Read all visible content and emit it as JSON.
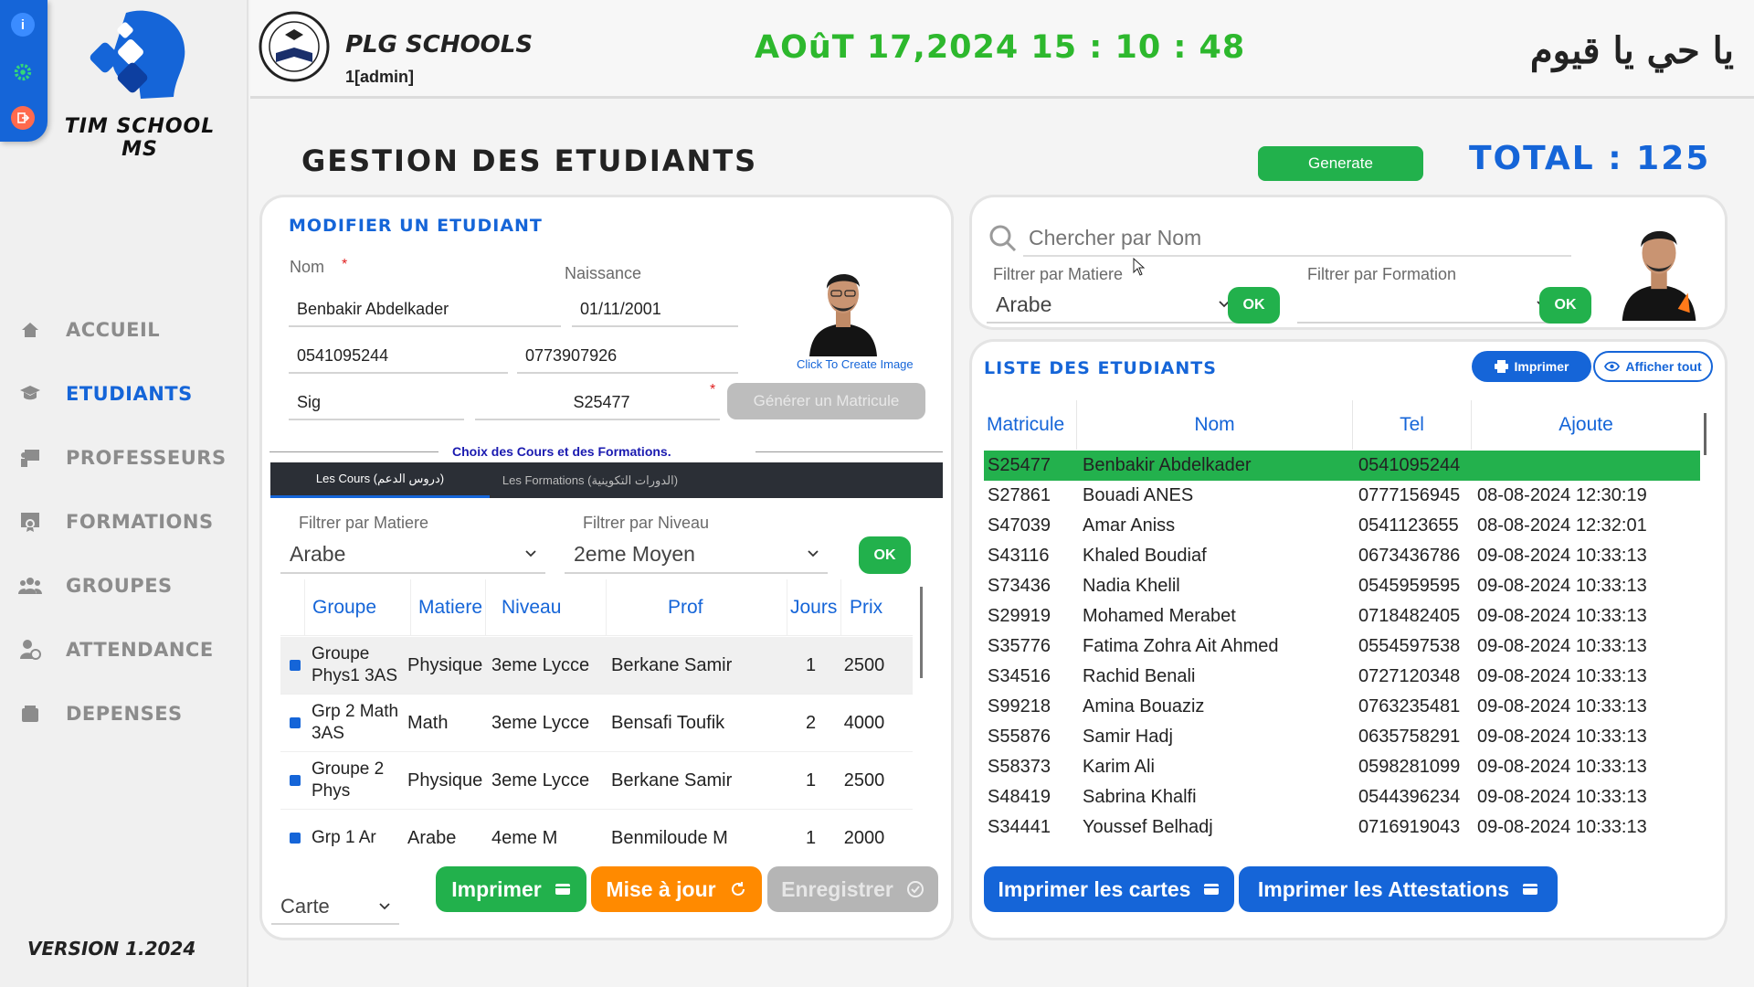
{
  "app": {
    "name": "TIM SCHOOL MS",
    "version": "VERSION 1.2024"
  },
  "top_strip": {
    "info_icon": "i",
    "settings_icon": "gear-icon",
    "logout_icon": "logout-icon"
  },
  "sidebar": {
    "items": [
      {
        "label": "ACCUEIL",
        "icon": "home-icon",
        "active": false
      },
      {
        "label": "ETUDIANTS",
        "icon": "graduation-cap-icon",
        "active": true
      },
      {
        "label": "PROFESSEURS",
        "icon": "teacher-icon",
        "active": false
      },
      {
        "label": "FORMATIONS",
        "icon": "certificate-icon",
        "active": false
      },
      {
        "label": "GROUPES",
        "icon": "users-icon",
        "active": false
      },
      {
        "label": "ATTENDANCE",
        "icon": "user-clock-icon",
        "active": false
      },
      {
        "label": "DEPENSES",
        "icon": "wallet-icon",
        "active": false
      }
    ]
  },
  "header": {
    "school_name": "PLG SCHOOLS",
    "user": "1[admin]",
    "datetime": "AOûT 17,2024 15 : 10 : 48",
    "arabic_text": "يا حي يا قيوم"
  },
  "page": {
    "title": "GESTION DES ETUDIANTS",
    "generate_label": "Generate",
    "total": "TOTAL : 125"
  },
  "edit_form": {
    "title": "MODIFIER UN ETUDIANT",
    "nom_label": "Nom",
    "required_mark": "*",
    "naissance_label": "Naissance",
    "nom": "Benbakir Abdelkader",
    "naissance": "01/11/2001",
    "tel1": "0541095244",
    "tel2": "0773907926",
    "adresse": "Sig",
    "matricule": "S25477",
    "generate_matricule_label": "Générer un Matricule",
    "photo_caption": "Click To Create Image",
    "choice_label": "Choix des Cours et des Formations.",
    "tabs": [
      "Les Cours (دروس الدعم)",
      "Les Formations (الدورات التكوينية)"
    ],
    "filter_matiere_label": "Filtrer par Matiere",
    "filter_matiere_value": "Arabe",
    "filter_niveau_label": "Filtrer par Niveau",
    "filter_niveau_value": "2eme Moyen",
    "ok_label": "OK",
    "course_columns": [
      "Groupe",
      "Matiere",
      "Niveau",
      "Prof",
      "Jours",
      "Prix"
    ],
    "courses": [
      {
        "groupe": "Groupe Phys1 3AS",
        "matiere": "Physique",
        "niveau": "3eme Lycce",
        "prof": "Berkane Samir",
        "jours": "1",
        "prix": "2500"
      },
      {
        "groupe": "Grp 2 Math 3AS",
        "matiere": "Math",
        "niveau": "3eme Lycce",
        "prof": "Bensafi Toufik",
        "jours": "2",
        "prix": "4000"
      },
      {
        "groupe": "Groupe 2 Phys",
        "matiere": "Physique",
        "niveau": "3eme Lycce",
        "prof": "Berkane Samir",
        "jours": "1",
        "prix": "2500"
      },
      {
        "groupe": "Grp 1 Ar",
        "matiere": "Arabe",
        "niveau": "4eme M",
        "prof": "Benmiloude M",
        "jours": "1",
        "prix": "2000"
      }
    ],
    "print_type_value": "Carte",
    "imprimer_label": "Imprimer",
    "update_label": "Mise à jour",
    "save_label": "Enregistrer"
  },
  "search_panel": {
    "search_placeholder": "Chercher par Nom",
    "filter_matiere_label": "Filtrer par Matiere",
    "filter_matiere_value": "Arabe",
    "filter_formation_label": "Filtrer par Formation",
    "filter_formation_value": "",
    "ok_label": "OK"
  },
  "students_list": {
    "title": "LISTE DES ETUDIANTS",
    "print_label": "Imprimer",
    "show_all_label": "Afficher tout",
    "columns": [
      "Matricule",
      "Nom",
      "Tel",
      "Ajoute"
    ],
    "rows": [
      {
        "matricule": "S25477",
        "nom": "Benbakir Abdelkader",
        "tel": "0541095244",
        "ajoute": "",
        "selected": true
      },
      {
        "matricule": "S27861",
        "nom": "Bouadi ANES",
        "tel": "0777156945",
        "ajoute": "08-08-2024 12:30:19"
      },
      {
        "matricule": "S47039",
        "nom": "Amar Aniss",
        "tel": "0541123655",
        "ajoute": "08-08-2024 12:32:01"
      },
      {
        "matricule": "S43116",
        "nom": "Khaled Boudiaf",
        "tel": "0673436786",
        "ajoute": "09-08-2024 10:33:13"
      },
      {
        "matricule": "S73436",
        "nom": "Nadia Khelil",
        "tel": "0545959595",
        "ajoute": "09-08-2024 10:33:13"
      },
      {
        "matricule": "S29919",
        "nom": "Mohamed Merabet",
        "tel": "0718482405",
        "ajoute": "09-08-2024 10:33:13"
      },
      {
        "matricule": "S35776",
        "nom": "Fatima Zohra Ait Ahmed",
        "tel": "0554597538",
        "ajoute": "09-08-2024 10:33:13"
      },
      {
        "matricule": "S34516",
        "nom": "Rachid Benali",
        "tel": "0727120348",
        "ajoute": "09-08-2024 10:33:13"
      },
      {
        "matricule": "S99218",
        "nom": "Amina Bouaziz",
        "tel": "0763235481",
        "ajoute": "09-08-2024 10:33:13"
      },
      {
        "matricule": "S55876",
        "nom": "Samir Hadj",
        "tel": "0635758291",
        "ajoute": "09-08-2024 10:33:13"
      },
      {
        "matricule": "S58373",
        "nom": "Karim Ali",
        "tel": "0598281099",
        "ajoute": "09-08-2024 10:33:13"
      },
      {
        "matricule": "S48419",
        "nom": "Sabrina Khalfi",
        "tel": "0544396234",
        "ajoute": "09-08-2024 10:33:13"
      },
      {
        "matricule": "S34441",
        "nom": "Youssef Belhadj",
        "tel": "0716919043",
        "ajoute": "09-08-2024 10:33:13"
      }
    ],
    "print_cards_label": "Imprimer les cartes",
    "print_attest_label": "Imprimer les Attestations"
  },
  "colors": {
    "accent": "#1565d8",
    "green": "#22b14c",
    "orange": "#ff8a00",
    "disabled": "#b5b5b5",
    "selected_row": "#23b14d"
  }
}
